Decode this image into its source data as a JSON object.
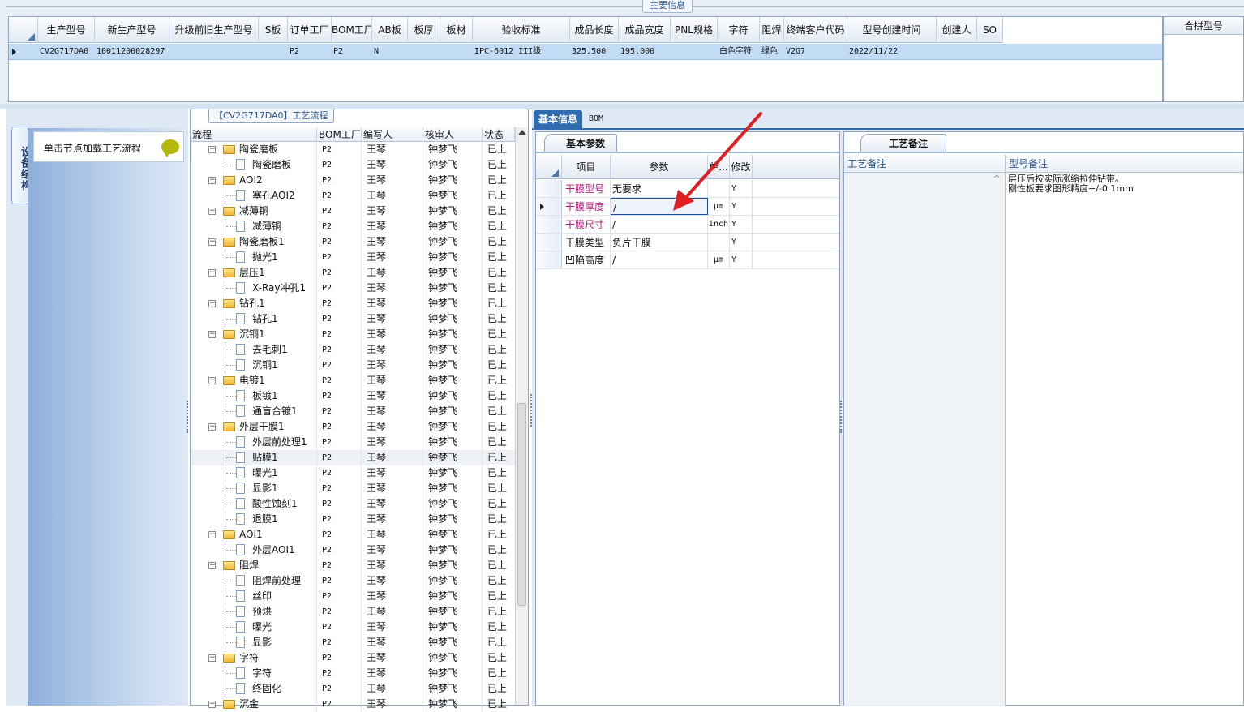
{
  "top": {
    "group_title": "主要信息",
    "columns": [
      "生产型号",
      "新生产型号",
      "升级前旧生产型号",
      "S板",
      "订单工厂",
      "BOM工厂",
      "AB板",
      "板厚",
      "板材",
      "验收标准",
      "成品长度",
      "成品宽度",
      "PNL规格",
      "字符",
      "阻焊",
      "终端客户代码",
      "型号创建时间",
      "创建人",
      "SO"
    ],
    "row": [
      "CV2G717DA0",
      "10011200028297",
      "",
      "",
      "P2",
      "P2",
      "N",
      "",
      "",
      "IPC-6012 III级",
      "325.500",
      "195.000",
      "",
      "白色字符",
      "绿色",
      "V2G7",
      "2022/11/22",
      "",
      ""
    ],
    "merge_header": "合拼型号"
  },
  "left": {
    "vtab": "设备结构",
    "card_text": "单击节点加载工艺流程"
  },
  "tree": {
    "title": "【CV2G717DA0】工艺流程",
    "headers": [
      "流程",
      "BOM工厂",
      "编写人",
      "核审人",
      "状态"
    ],
    "bom": "P2",
    "writer": "王琴",
    "reviewer": "钟梦飞",
    "status": "已上",
    "rows": [
      {
        "name": "陶瓷磨板",
        "lv": 0
      },
      {
        "name": "陶瓷磨板",
        "lv": 1
      },
      {
        "name": "AOI2",
        "lv": 0
      },
      {
        "name": "塞孔AOI2",
        "lv": 1
      },
      {
        "name": "减薄铜",
        "lv": 0
      },
      {
        "name": "减薄铜",
        "lv": 1
      },
      {
        "name": "陶瓷磨板1",
        "lv": 0
      },
      {
        "name": "抛光1",
        "lv": 1
      },
      {
        "name": "层压1",
        "lv": 0
      },
      {
        "name": "X-Ray冲孔1",
        "lv": 1
      },
      {
        "name": "钻孔1",
        "lv": 0
      },
      {
        "name": "钻孔1",
        "lv": 1
      },
      {
        "name": "沉铜1",
        "lv": 0
      },
      {
        "name": "去毛刺1",
        "lv": 1
      },
      {
        "name": "沉铜1",
        "lv": 1
      },
      {
        "name": "电镀1",
        "lv": 0
      },
      {
        "name": "板镀1",
        "lv": 1
      },
      {
        "name": "通盲合镀1",
        "lv": 1
      },
      {
        "name": "外层干膜1",
        "lv": 0
      },
      {
        "name": "外层前处理1",
        "lv": 1
      },
      {
        "name": "贴膜1",
        "lv": 1,
        "sel": true
      },
      {
        "name": "曝光1",
        "lv": 1
      },
      {
        "name": "显影1",
        "lv": 1
      },
      {
        "name": "酸性蚀刻1",
        "lv": 1
      },
      {
        "name": "退膜1",
        "lv": 1
      },
      {
        "name": "AOI1",
        "lv": 0
      },
      {
        "name": "外层AOI1",
        "lv": 1
      },
      {
        "name": "阻焊",
        "lv": 0
      },
      {
        "name": "阻焊前处理",
        "lv": 1
      },
      {
        "name": "丝印",
        "lv": 1
      },
      {
        "name": "预烘",
        "lv": 1
      },
      {
        "name": "曝光",
        "lv": 1
      },
      {
        "name": "显影",
        "lv": 1
      },
      {
        "name": "字符",
        "lv": 0
      },
      {
        "name": "字符",
        "lv": 1
      },
      {
        "name": "终固化",
        "lv": 1
      },
      {
        "name": "沉金",
        "lv": 0
      }
    ]
  },
  "right": {
    "tabs": [
      "基本信息",
      "BOM"
    ],
    "basic_tab": "基本参数",
    "param_headers": [
      "项目",
      "参数",
      "单...",
      "修改"
    ],
    "params": [
      {
        "k": "干膜型号",
        "v": "无要求",
        "u": "",
        "m": "Y",
        "red": true
      },
      {
        "k": "干膜厚度",
        "v": "/",
        "u": "μm",
        "m": "Y",
        "red": true,
        "cur": true
      },
      {
        "k": "干膜尺寸",
        "v": "/",
        "u": "inch",
        "m": "Y",
        "red": true
      },
      {
        "k": "干膜类型",
        "v": "负片干膜",
        "u": "",
        "m": "Y",
        "red": false
      },
      {
        "k": "凹陷高度",
        "v": "/",
        "u": "μm",
        "m": "Y",
        "red": false
      }
    ],
    "remarks_tab": "工艺备注",
    "remark_h1": "工艺备注",
    "remark_h2": "型号备注",
    "remark_text": "层压后按实际涨缩拉伸钻带。\n刚性板要求图形精度+/-0.1mm"
  },
  "colors": {
    "accent": "#2f6cb0",
    "selection": "#c3dcf5",
    "arrow": "#e02020"
  }
}
